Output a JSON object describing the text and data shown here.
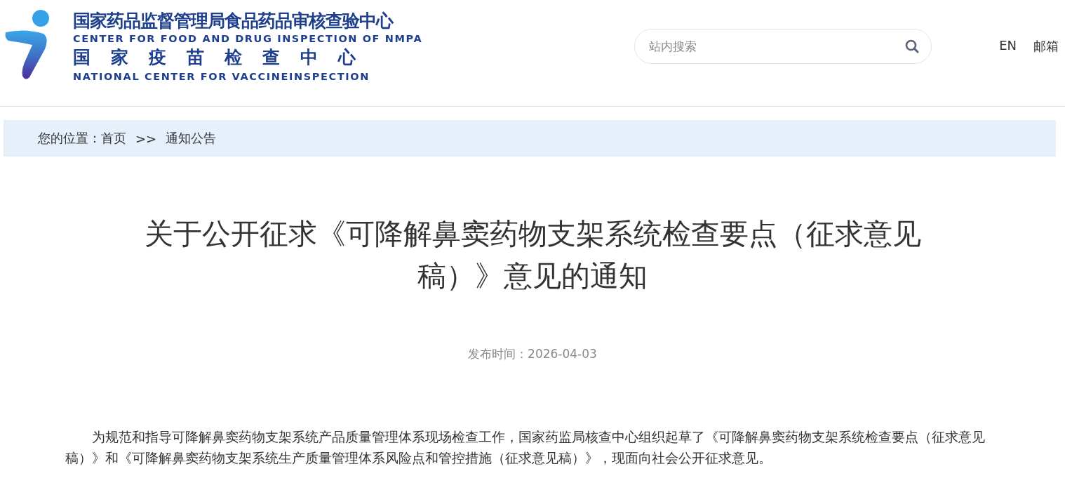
{
  "logo": {
    "title_cn": "国家药品监督管理局食品药品审核查验中心",
    "title_en": "CENTER FOR FOOD AND DRUG INSPECTION OF NMPA",
    "subtitle_cn": "国家疫苗检查中心",
    "subtitle_en": "NATIONAL CENTER FOR VACCINEINSPECTION"
  },
  "search": {
    "placeholder": "站内搜索"
  },
  "header_links": [
    "EN",
    "邮箱"
  ],
  "breadcrumb": {
    "label": "您的位置：",
    "items": [
      "首页",
      "通知公告"
    ],
    "separator": ">>"
  },
  "article": {
    "title": "关于公开征求《可降解鼻窦药物支架系统检查要点（征求意见稿）》意见的通知",
    "date": "发布时间：2026-04-03",
    "body": "为规范和指导可降解鼻窦药物支架系统产品质量管理体系现场检查工作，国家药监局核查中心组织起草了《可降解鼻窦药物支架系统检查要点（征求意见稿）》和《可降解鼻窦药物支架系统生产质量管理体系风险点和管控措施（征求意见稿）》，现面向社会公开征求意见。"
  }
}
